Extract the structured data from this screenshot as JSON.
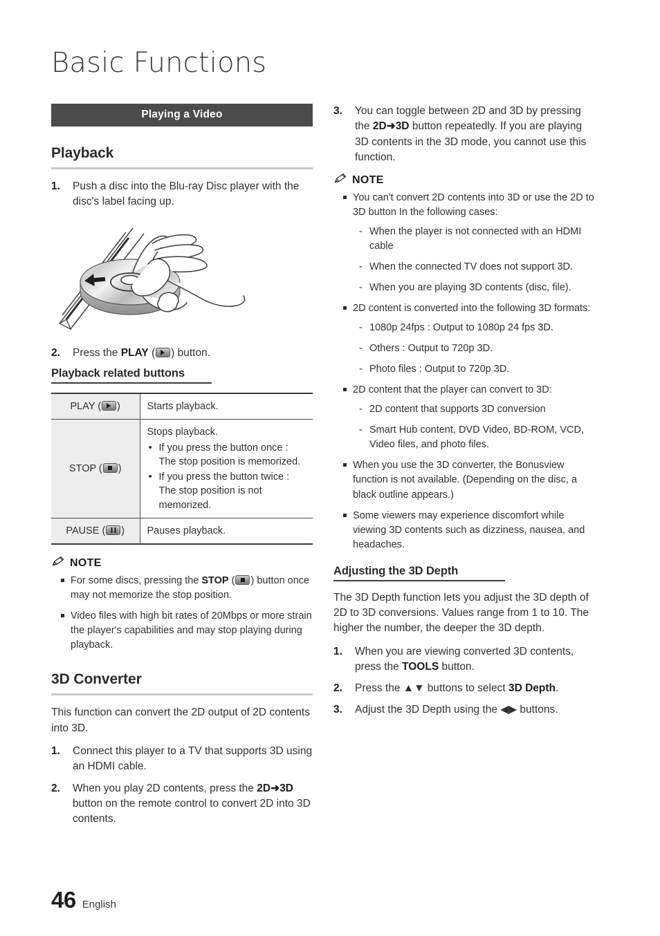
{
  "page": {
    "chapter_title": "Basic Functions",
    "footer_page_number": "46",
    "footer_language": "English",
    "accent_bar_color": "#4b4b4b",
    "rule_color": "#c9c9c9",
    "table_header_cell_color": "#ededed",
    "text_color": "#333031"
  },
  "section_bar": {
    "label": "Playing a Video"
  },
  "playback": {
    "heading": "Playback",
    "step1_num": "1.",
    "step1_text": "Push a disc into the Blu-ray Disc player with the disc's label facing up.",
    "illustration_name": "disc-insertion-illustration",
    "step2_num": "2.",
    "step2_pre": "Press the ",
    "step2_bold": "PLAY",
    "step2_open": " (",
    "step2_close": ") button.",
    "play_icon_name": "play-button-icon"
  },
  "related_buttons": {
    "heading": "Playback related buttons",
    "rows": [
      {
        "button_label_pre": "PLAY (",
        "button_label_post": ")",
        "icon": "play-button-icon",
        "description": "Starts playback.",
        "bullets": []
      },
      {
        "button_label_pre": "STOP (",
        "button_label_post": ")",
        "icon": "stop-button-icon",
        "description": "Stops playback.",
        "bullets": [
          "If you press the button once : The stop position is memorized.",
          "If you press the button twice : The stop position is not memorized."
        ]
      },
      {
        "button_label_pre": "PAUSE (",
        "button_label_post": ")",
        "icon": "pause-button-icon",
        "description": "Pauses playback.",
        "bullets": []
      }
    ]
  },
  "note_left": {
    "label": "NOTE",
    "icon": "pencil-icon",
    "item1_pre": "For some discs, pressing the ",
    "item1_bold": "STOP",
    "item1_open": " (",
    "item1_post": ") button once may not memorize the stop position.",
    "item2": "Video files with high bit rates of 20Mbps or more strain the player's capabilities and may stop playing during playback."
  },
  "converter": {
    "heading": "3D Converter",
    "intro": "This function can convert the 2D output of 2D contents into 3D.",
    "step1_num": "1.",
    "step1_text": "Connect this player to a TV that supports 3D using an HDMI cable.",
    "step2_num": "2.",
    "step2_pre": "When you play 2D contents, press the ",
    "step2_bold_a": "2D",
    "step2_arrow": "➜",
    "step2_bold_b": "3D",
    "step2_post": " button on the remote control to convert 2D into 3D contents.",
    "step3_num": "3.",
    "step3_pre": "You can toggle between 2D and 3D by pressing the ",
    "step3_bold_a": "2D",
    "step3_arrow": "➜",
    "step3_bold_b": "3D",
    "step3_post": " button repeatedly. If you are playing 3D contents in the 3D mode, you cannot use this function."
  },
  "note_right": {
    "label": "NOTE",
    "icon": "pencil-icon",
    "items": [
      {
        "text": "You can't convert 2D contents into 3D or use the 2D to 3D button In the following cases:",
        "sub": [
          "When the player is not connected with an HDMI cable",
          "When the connected TV does not support 3D.",
          "When you are playing 3D contents (disc, file)."
        ]
      },
      {
        "text": "2D content is converted into the following 3D formats:",
        "sub": [
          "1080p 24fps : Output to 1080p 24 fps 3D.",
          "Others : Output to 720p 3D.",
          "Photo files : Output to 720p 3D."
        ]
      },
      {
        "text": "2D content that the player can convert to 3D:",
        "sub": [
          "2D content that supports 3D conversion",
          "Smart Hub content, DVD Video, BD-ROM, VCD, Video files, and photo files."
        ]
      },
      {
        "text": "When you use the 3D converter, the Bonusview function is not available. (Depending on the disc, a black outline appears.)",
        "sub": []
      },
      {
        "text": "Some viewers may experience discomfort while viewing 3D contents such as dizziness, nausea, and headaches.",
        "sub": []
      }
    ]
  },
  "depth": {
    "heading": "Adjusting the 3D Depth",
    "intro": "The 3D Depth function lets you adjust the 3D depth of 2D to 3D conversions. Values range from 1 to 10. The higher the number, the deeper the 3D depth.",
    "step1_num": "1.",
    "step1_pre": "When you are viewing converted 3D contents, press the ",
    "step1_bold": "TOOLS",
    "step1_post": " button.",
    "step2_num": "2.",
    "step2_pre": "Press the ",
    "step2_arrows": "▲▼",
    "step2_mid": " buttons to select ",
    "step2_bold": "3D Depth",
    "step2_post": ".",
    "step3_num": "3.",
    "step3_pre": "Adjust the 3D Depth using the ",
    "step3_arrows": "◀▶",
    "step3_post": " buttons."
  }
}
